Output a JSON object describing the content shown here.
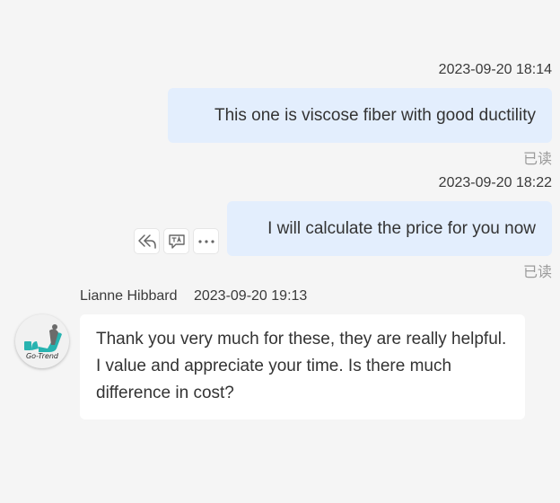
{
  "messages": [
    {
      "direction": "outgoing",
      "timestamp": "2023-09-20 18:14",
      "text": "This one is viscose fiber with good ductility",
      "status": "已读"
    },
    {
      "direction": "outgoing",
      "timestamp": "2023-09-20 18:22",
      "text": "I will calculate the price for you now",
      "status": "已读",
      "actions": [
        "reply-icon",
        "translate-icon",
        "more-icon"
      ]
    },
    {
      "direction": "incoming",
      "sender": "Lianne Hibbard",
      "timestamp": "2023-09-20 19:13",
      "avatar_text": "Go-Trend",
      "text": "Thank you very much for these, they are really helpful. I value and appreciate your time. Is there much difference in cost?"
    }
  ],
  "colors": {
    "background": "#f5f5f5",
    "outgoing_bubble": "#e3eefd",
    "incoming_bubble": "#ffffff",
    "read_status": "#9a9a9a",
    "avatar_accent": "#28b3b0"
  }
}
